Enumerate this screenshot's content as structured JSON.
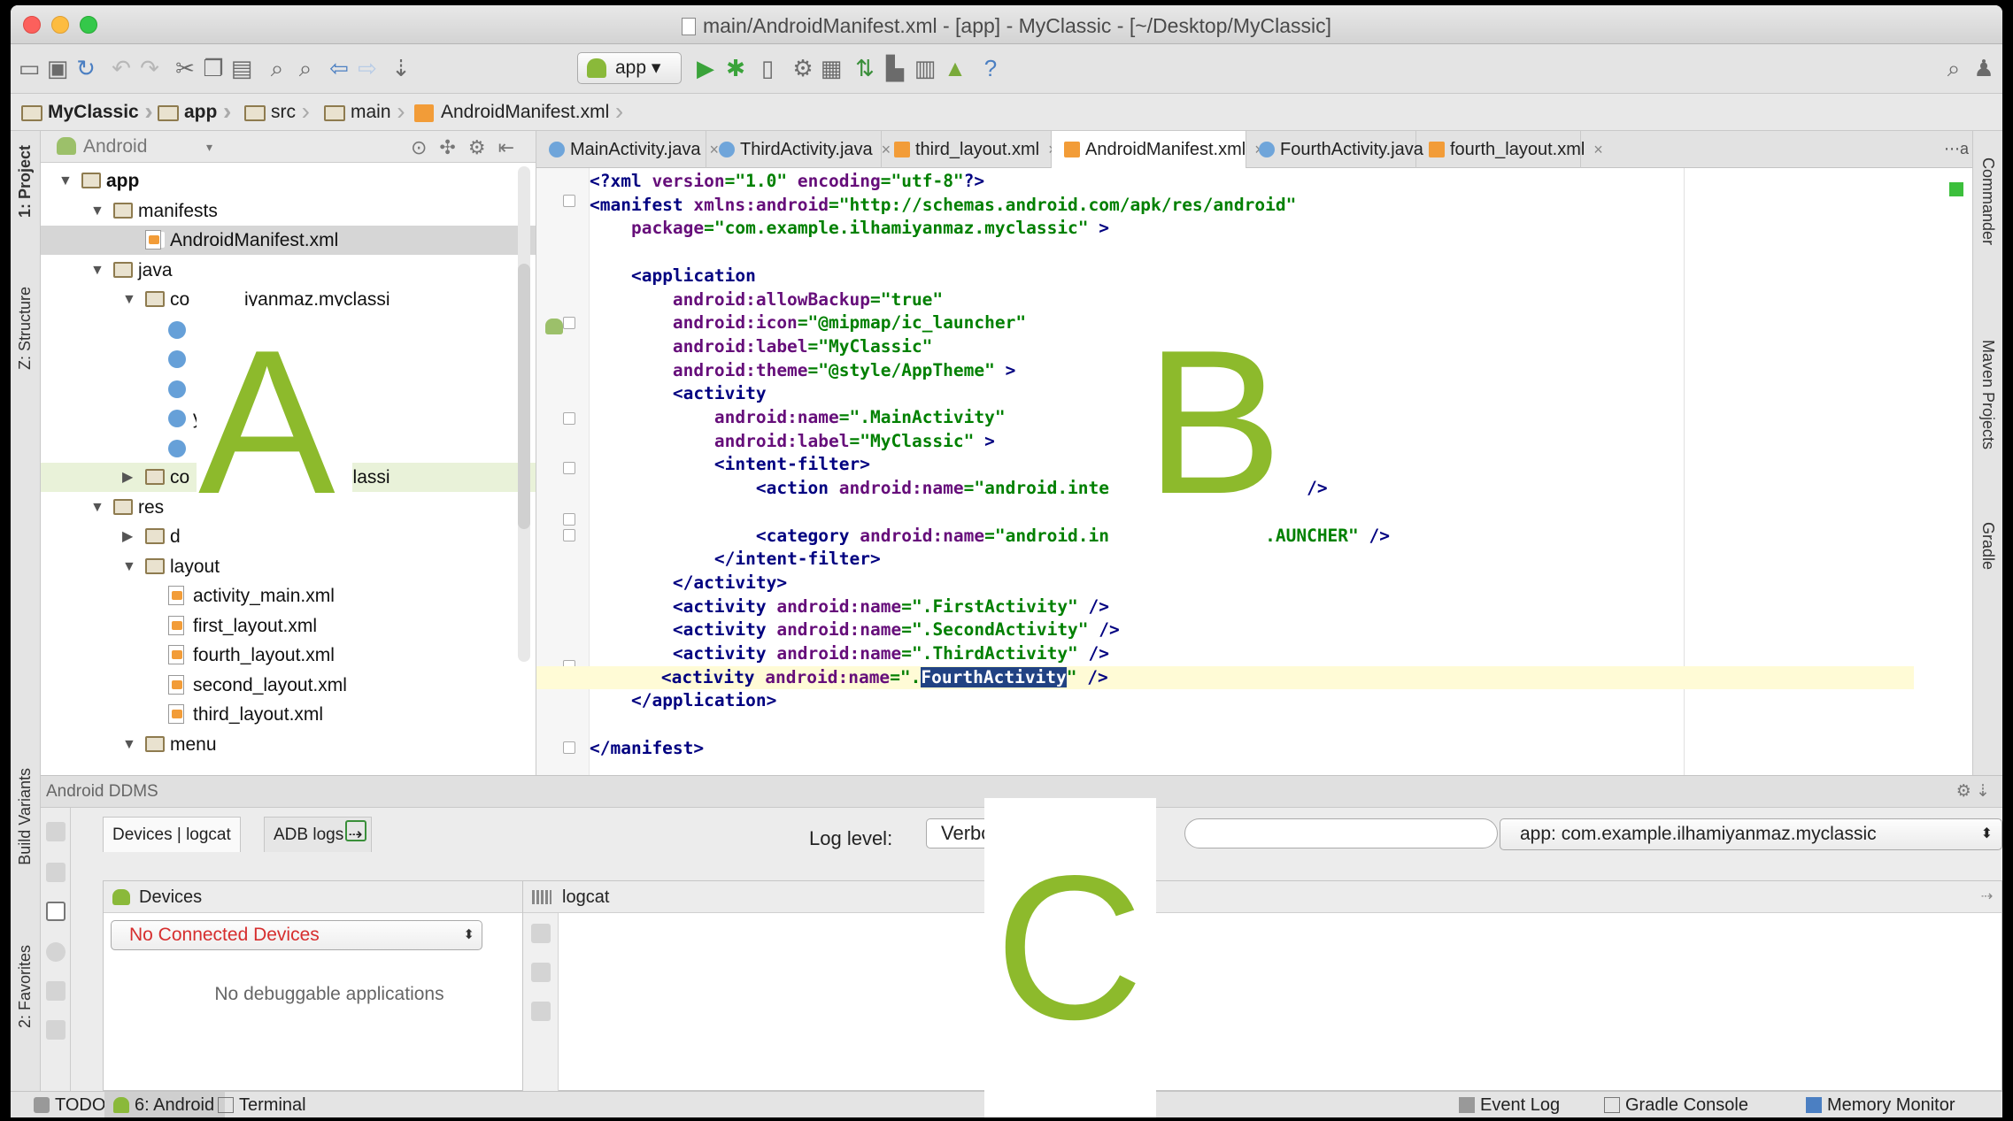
{
  "window": {
    "title": "main/AndroidManifest.xml - [app] - MyClassic - [~/Desktop/MyClassic]"
  },
  "toolbar": {
    "run_config": "app",
    "icons": [
      "open-icon",
      "save-icon",
      "sync-icon",
      "undo-icon",
      "redo-icon",
      "cut-icon",
      "copy-icon",
      "paste-icon",
      "find-icon",
      "replace-icon",
      "back-icon",
      "forward-icon",
      "make-icon",
      "run-icon",
      "debug-icon",
      "attach-icon",
      "sdk-manager-icon",
      "avd-icon",
      "sync-gradle-icon",
      "device-monitor-icon",
      "android-icon",
      "help-icon",
      "search-icon"
    ]
  },
  "breadcrumb": [
    "MyClassic",
    "app",
    "src",
    "main",
    "AndroidManifest.xml"
  ],
  "left_strip": {
    "project": "1: Project",
    "structure": "Z: Structure",
    "build_variants": "Build Variants",
    "favorites": "2: Favorites"
  },
  "right_strip": {
    "commander": "Commander",
    "maven": "Maven Projects",
    "gradle": "Gradle"
  },
  "project_panel": {
    "view_mode": "Android",
    "tree": [
      {
        "label": "app",
        "level": 0,
        "type": "module",
        "open": true
      },
      {
        "label": "manifests",
        "level": 1,
        "type": "folder",
        "open": true
      },
      {
        "label": "AndroidManifest.xml",
        "level": 2,
        "type": "xml",
        "selected": true
      },
      {
        "label": "java",
        "level": 1,
        "type": "folder",
        "open": true
      },
      {
        "label": "co",
        "suffix": "iyanmaz.myclassi",
        "level": 2,
        "type": "package",
        "open": true
      },
      {
        "label": "",
        "level": 3,
        "type": "class"
      },
      {
        "label": "",
        "level": 3,
        "type": "class"
      },
      {
        "label": "",
        "level": 3,
        "type": "class"
      },
      {
        "label": "y",
        "level": 3,
        "type": "class"
      },
      {
        "label": "",
        "level": 3,
        "type": "class"
      },
      {
        "label": "co",
        "suffix": "iyanmaz.myclassi",
        "level": 2,
        "type": "package",
        "open": false,
        "highlight": true
      },
      {
        "label": "res",
        "level": 1,
        "type": "folder",
        "open": true
      },
      {
        "label": "d",
        "level": 2,
        "type": "folder"
      },
      {
        "label": "layout",
        "level": 2,
        "type": "folder",
        "open": true
      },
      {
        "label": "activity_main.xml",
        "level": 3,
        "type": "xml"
      },
      {
        "label": "first_layout.xml",
        "level": 3,
        "type": "xml"
      },
      {
        "label": "fourth_layout.xml",
        "level": 3,
        "type": "xml"
      },
      {
        "label": "second_layout.xml",
        "level": 3,
        "type": "xml"
      },
      {
        "label": "third_layout.xml",
        "level": 3,
        "type": "xml"
      },
      {
        "label": "menu",
        "level": 2,
        "type": "folder",
        "open": true
      }
    ]
  },
  "editor": {
    "tabs": [
      {
        "label": "MainActivity.java",
        "kind": "java"
      },
      {
        "label": "ThirdActivity.java",
        "kind": "java"
      },
      {
        "label": "third_layout.xml",
        "kind": "xml"
      },
      {
        "label": "AndroidManifest.xml",
        "kind": "xml",
        "active": true
      },
      {
        "label": "FourthActivity.java",
        "kind": "java"
      },
      {
        "label": "fourth_layout.xml",
        "kind": "xml"
      }
    ],
    "tabs_overflow": "⋯a"
  },
  "ddms": {
    "title": "Android DDMS",
    "subtabs": [
      "Devices | logcat",
      "ADB logs"
    ],
    "log_level_label": "Log level:",
    "log_level_value": "Verbos",
    "app_filter": "app: com.example.ilhamiyanmaz.myclassic",
    "devices_title": "Devices",
    "device_select": "No Connected Devices",
    "no_apps": "No debuggable applications",
    "logcat_title": "logcat"
  },
  "statusbar": {
    "todo": "TODO",
    "android": "6: Android",
    "terminal": "Terminal",
    "event_log": "Event Log",
    "gradle_console": "Gradle Console",
    "memory_monitor": "Memory Monitor"
  },
  "overlay": {
    "a": "A",
    "b": "B",
    "c": "C"
  },
  "colors": {
    "overlay_green": "#8dba2c",
    "xml_tag": "#000080",
    "xml_attr": "#660e7a",
    "xml_value": "#008000",
    "selection": "#214283"
  }
}
